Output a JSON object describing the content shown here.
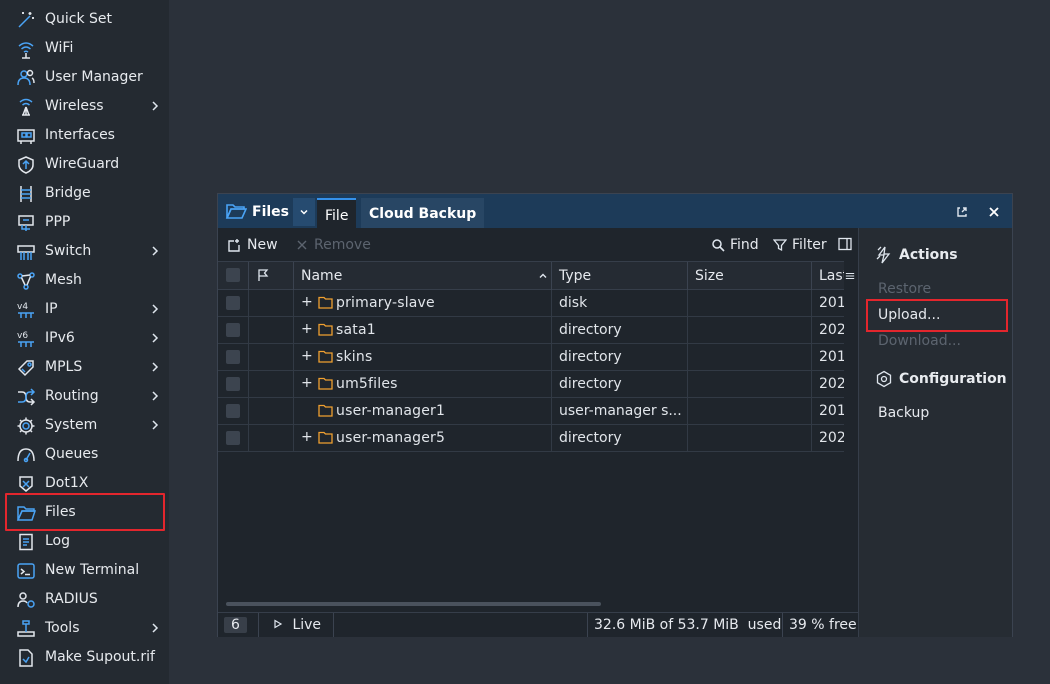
{
  "sidebar": {
    "items": [
      {
        "label": "Quick Set",
        "icon": "magic-wand-icon",
        "submenu": false
      },
      {
        "label": "WiFi",
        "icon": "wifi-icon",
        "submenu": false
      },
      {
        "label": "User Manager",
        "icon": "users-icon",
        "submenu": false
      },
      {
        "label": "Wireless",
        "icon": "antenna-icon",
        "submenu": true
      },
      {
        "label": "Interfaces",
        "icon": "interface-card-icon",
        "submenu": false
      },
      {
        "label": "WireGuard",
        "icon": "wireguard-shield-icon",
        "submenu": false
      },
      {
        "label": "Bridge",
        "icon": "bridge-icon",
        "submenu": false
      },
      {
        "label": "PPP",
        "icon": "ppp-icon",
        "submenu": false
      },
      {
        "label": "Switch",
        "icon": "switch-icon",
        "submenu": true
      },
      {
        "label": "Mesh",
        "icon": "mesh-icon",
        "submenu": false
      },
      {
        "label": "IP",
        "icon": "ipv4-icon",
        "submenu": true
      },
      {
        "label": "IPv6",
        "icon": "ipv6-icon",
        "submenu": true
      },
      {
        "label": "MPLS",
        "icon": "tag-icon",
        "submenu": true
      },
      {
        "label": "Routing",
        "icon": "routing-shuffle-icon",
        "submenu": true
      },
      {
        "label": "System",
        "icon": "gear-icon",
        "submenu": true
      },
      {
        "label": "Queues",
        "icon": "gauge-icon",
        "submenu": false
      },
      {
        "label": "Dot1X",
        "icon": "dot1x-icon",
        "submenu": false
      },
      {
        "label": "Files",
        "icon": "folder-icon",
        "submenu": false
      },
      {
        "label": "Log",
        "icon": "log-icon",
        "submenu": false
      },
      {
        "label": "New Terminal",
        "icon": "terminal-icon",
        "submenu": false
      },
      {
        "label": "RADIUS",
        "icon": "radius-icon",
        "submenu": false
      },
      {
        "label": "Tools",
        "icon": "tools-icon",
        "submenu": true
      },
      {
        "label": "Make Supout.rif",
        "icon": "supout-file-icon",
        "submenu": false
      }
    ]
  },
  "window": {
    "title": "Files",
    "tabs": {
      "file": "File",
      "cloud": "Cloud Backup"
    },
    "toolbar": {
      "new": "New",
      "remove": "Remove",
      "find": "Find",
      "filter": "Filter"
    },
    "columns": {
      "name": "Name",
      "type": "Type",
      "size": "Size",
      "last": "Last"
    },
    "rows": [
      {
        "name": "primary-slave",
        "type": "disk",
        "size": "",
        "last": "201",
        "expandable": true
      },
      {
        "name": "sata1",
        "type": "directory",
        "size": "",
        "last": "202",
        "expandable": true
      },
      {
        "name": "skins",
        "type": "directory",
        "size": "",
        "last": "201",
        "expandable": true
      },
      {
        "name": "um5files",
        "type": "directory",
        "size": "",
        "last": "202",
        "expandable": true
      },
      {
        "name": "user-manager1",
        "type": "user-manager s...",
        "size": "",
        "last": "201",
        "expandable": false
      },
      {
        "name": "user-manager5",
        "type": "directory",
        "size": "",
        "last": "202",
        "expandable": true
      }
    ],
    "status": {
      "count": "6",
      "live": "Live",
      "usage": "32.6 MiB of 53.7 MiB  used",
      "free": "39 % free"
    }
  },
  "actions": {
    "heading": "Actions",
    "restore": "Restore",
    "upload": "Upload...",
    "download": "Download...",
    "config_heading": "Configuration",
    "backup": "Backup"
  },
  "colors": {
    "accent": "#3591ea",
    "folder": "#f0a030",
    "highlight": "#e3262d",
    "titlebar": "#1d3b59"
  }
}
